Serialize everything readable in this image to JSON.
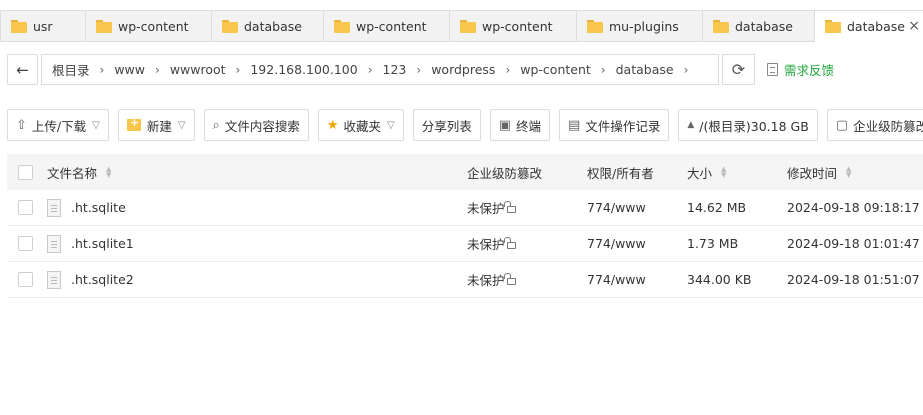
{
  "tabs": [
    {
      "label": "usr",
      "active": false
    },
    {
      "label": "wp-content",
      "active": false
    },
    {
      "label": "database",
      "active": false
    },
    {
      "label": "wp-content",
      "active": false
    },
    {
      "label": "wp-content",
      "active": false
    },
    {
      "label": "mu-plugins",
      "active": false
    },
    {
      "label": "database",
      "active": false
    },
    {
      "label": "database",
      "active": true,
      "close": "×"
    }
  ],
  "address": {
    "back": "←",
    "breadcrumbs": [
      "根目录",
      "www",
      "wwwroot",
      "192.168.100.100",
      "123",
      "wordpress",
      "wp-content",
      "database"
    ],
    "separator": "›",
    "refresh": "⟳",
    "feedback": "需求反馈"
  },
  "toolbar": {
    "upload": "上传/下载",
    "new": "新建",
    "search": "文件内容搜索",
    "favorites": "收藏夹",
    "share": "分享列表",
    "terminal": "终端",
    "oplog": "文件操作记录",
    "disk": "/(根目录)30.18 GB",
    "enterprise": "企业级防篡改"
  },
  "table": {
    "headers": {
      "name": "文件名称",
      "protect": "企业级防篡改",
      "perm": "权限/所有者",
      "size": "大小",
      "mtime": "修改时间"
    },
    "rows": [
      {
        "name": ".ht.sqlite",
        "protect": "未保护",
        "perm": "774/www",
        "size": "14.62 MB",
        "mtime": "2024-09-18 09:18:17"
      },
      {
        "name": ".ht.sqlite1",
        "protect": "未保护",
        "perm": "774/www",
        "size": "1.73 MB",
        "mtime": "2024-09-18 01:01:47"
      },
      {
        "name": ".ht.sqlite2",
        "protect": "未保护",
        "perm": "774/www",
        "size": "344.00 KB",
        "mtime": "2024-09-18 01:51:07"
      }
    ]
  },
  "colors": {
    "accent_green": "#20a53a",
    "folder_yellow": "#f7c64b"
  }
}
